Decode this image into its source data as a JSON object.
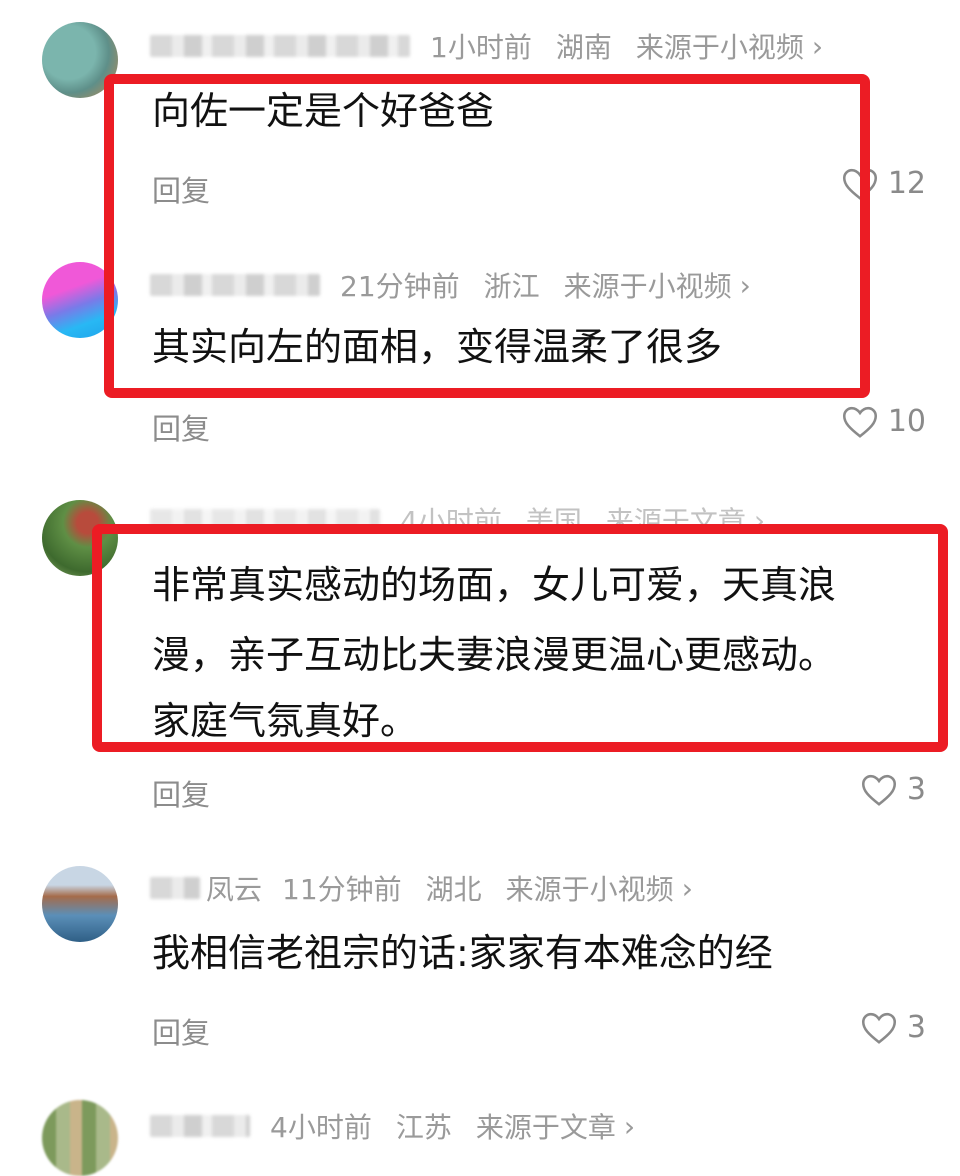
{
  "comments": [
    {
      "time": "1小时前",
      "region": "湖南",
      "source": "来源于小视频",
      "text": "向佐一定是个好爸爸",
      "reply": "回复",
      "likes": "12",
      "avatar_colors": [
        "#6ea6a0",
        "#e59a4a"
      ]
    },
    {
      "time": "21分钟前",
      "region": "浙江",
      "source": "来源于小视频",
      "text": "其实向左的面相，变得温柔了很多",
      "reply": "回复",
      "likes": "10",
      "avatar_colors": [
        "#e34fd0",
        "#2fb5f0"
      ]
    },
    {
      "time": "4小时前",
      "region": "美国",
      "source": "来源于文章",
      "text_lines": [
        "非常真实感动的场面，女儿可爱，天真浪",
        "漫，亲子互动比夫妻浪漫更温心更感动。",
        "家庭气氛真好。"
      ],
      "reply": "回复",
      "likes": "3",
      "avatar_colors": [
        "#4b7a3a",
        "#c1463a"
      ]
    },
    {
      "name_partial": "凤云",
      "time": "11分钟前",
      "region": "湖北",
      "source": "来源于小视频",
      "text": "我相信老祖宗的话:家家有本难念的经",
      "reply": "回复",
      "likes": "3",
      "avatar_colors": [
        "#5b8fb8",
        "#a36b4a"
      ]
    },
    {
      "time": "4小时前",
      "region": "江苏",
      "source": "来源于文章",
      "avatar_colors": [
        "#7d9a5c",
        "#c9b48a"
      ]
    }
  ],
  "chevron": "›",
  "colors": {
    "highlight": "#ec1c24"
  }
}
